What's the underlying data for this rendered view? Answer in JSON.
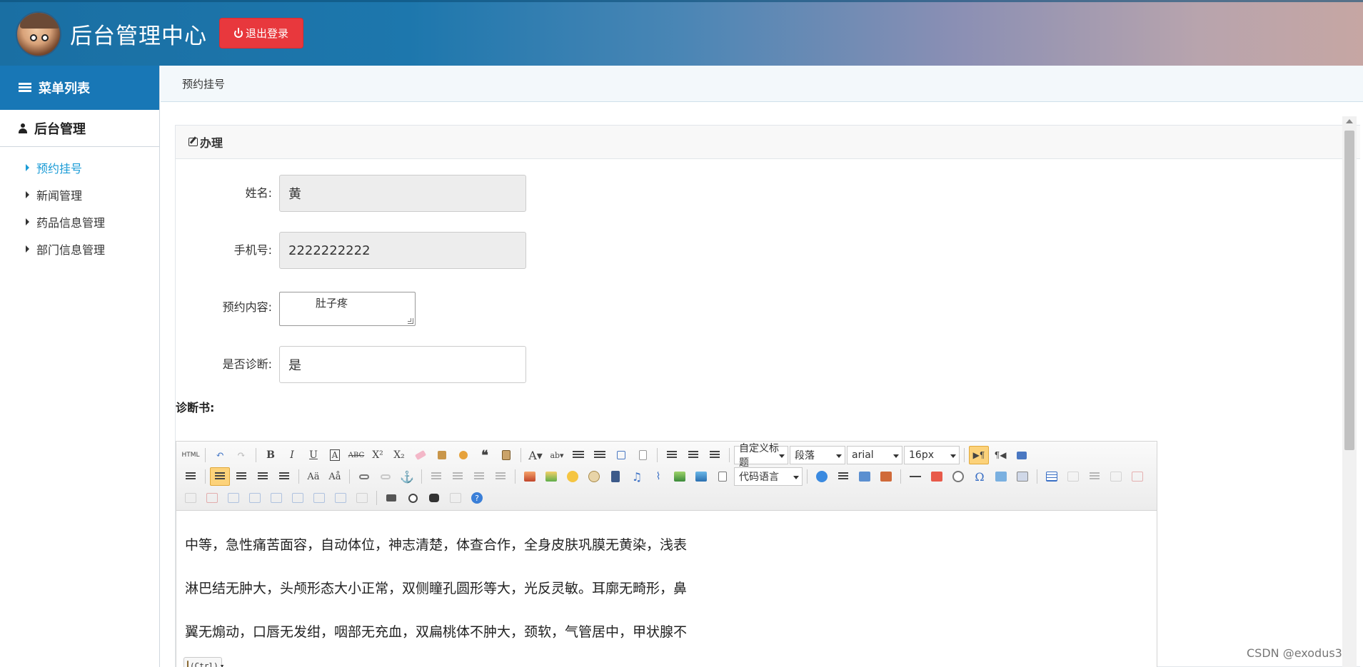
{
  "header": {
    "title": "后台管理中心",
    "logout_label": "退出登录"
  },
  "sidebar": {
    "menu_title": "菜单列表",
    "group_title": "后台管理",
    "items": [
      {
        "label": "预约挂号",
        "active": true
      },
      {
        "label": "新闻管理",
        "active": false
      },
      {
        "label": "药品信息管理",
        "active": false
      },
      {
        "label": "部门信息管理",
        "active": false
      }
    ]
  },
  "breadcrumb": "预约挂号",
  "panel": {
    "title": "办理"
  },
  "form": {
    "name_label": "姓名:",
    "name_value": "黄",
    "phone_label": "手机号:",
    "phone_value": "2222222222",
    "content_label": "预约内容:",
    "content_value": "肚子疼",
    "diagnosed_label": "是否诊断:",
    "diagnosed_value": "是",
    "diagnosis_label": "诊断书:"
  },
  "editor": {
    "toolbar": {
      "custom_heading": "自定义标题",
      "paragraph": "段落",
      "font_family": "arial",
      "font_size": "16px",
      "code_language": "代码语言"
    },
    "lines": [
      "中等，急性痛苦面容，自动体位，神志清楚，体查合作，全身皮肤巩膜无黄染，浅表",
      "淋巴结无肿大，头颅形态大小正常，双侧瞳孔圆形等大，光反灵敏。耳廓无畸形，鼻",
      "翼无煽动，口唇无发绀，咽部无充血，双扁桃体不肿大，颈软，气管居中，甲状腺不"
    ],
    "paste_hint": "(Ctrl)"
  },
  "colors": {
    "header_start": "#1a6fa3",
    "header_end": "#c6a6a3",
    "logout": "#e8383d",
    "menu_head": "#1877b6",
    "active_link": "#1a9bd6"
  },
  "watermark": "CSDN @exodus3"
}
